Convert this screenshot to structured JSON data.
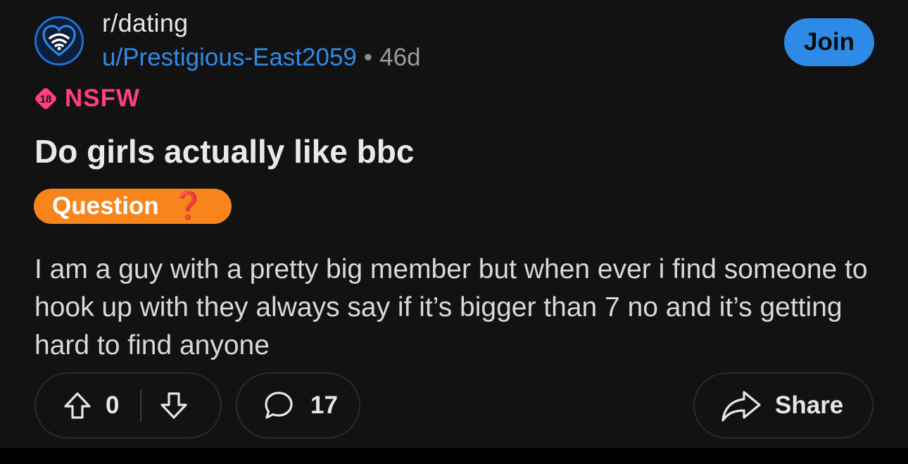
{
  "header": {
    "subreddit": "r/dating",
    "username": "u/Prestigious-East2059",
    "separator": "•",
    "age": "46d",
    "join_label": "Join",
    "avatar_icon": "subreddit-heart-wifi-icon"
  },
  "nsfw": {
    "badge_number": "18",
    "label": "NSFW",
    "color": "#ff3f7f"
  },
  "post": {
    "title": "Do girls actually like bbc",
    "flair_text": "Question",
    "flair_emoji": "❓",
    "flair_color": "#f7851c",
    "body": "I am a guy with a pretty big member but when ever i find someone to hook up with they always say if it’s bigger than 7 no and it’s getting hard to find anyone"
  },
  "actions": {
    "score": "0",
    "comment_count": "17",
    "share_label": "Share",
    "upvote_icon": "upvote-arrow-icon",
    "downvote_icon": "downvote-arrow-icon",
    "comment_icon": "comment-bubble-icon",
    "share_icon": "share-arrow-icon"
  },
  "colors": {
    "background": "#121212",
    "accent": "#2d8ae6"
  }
}
